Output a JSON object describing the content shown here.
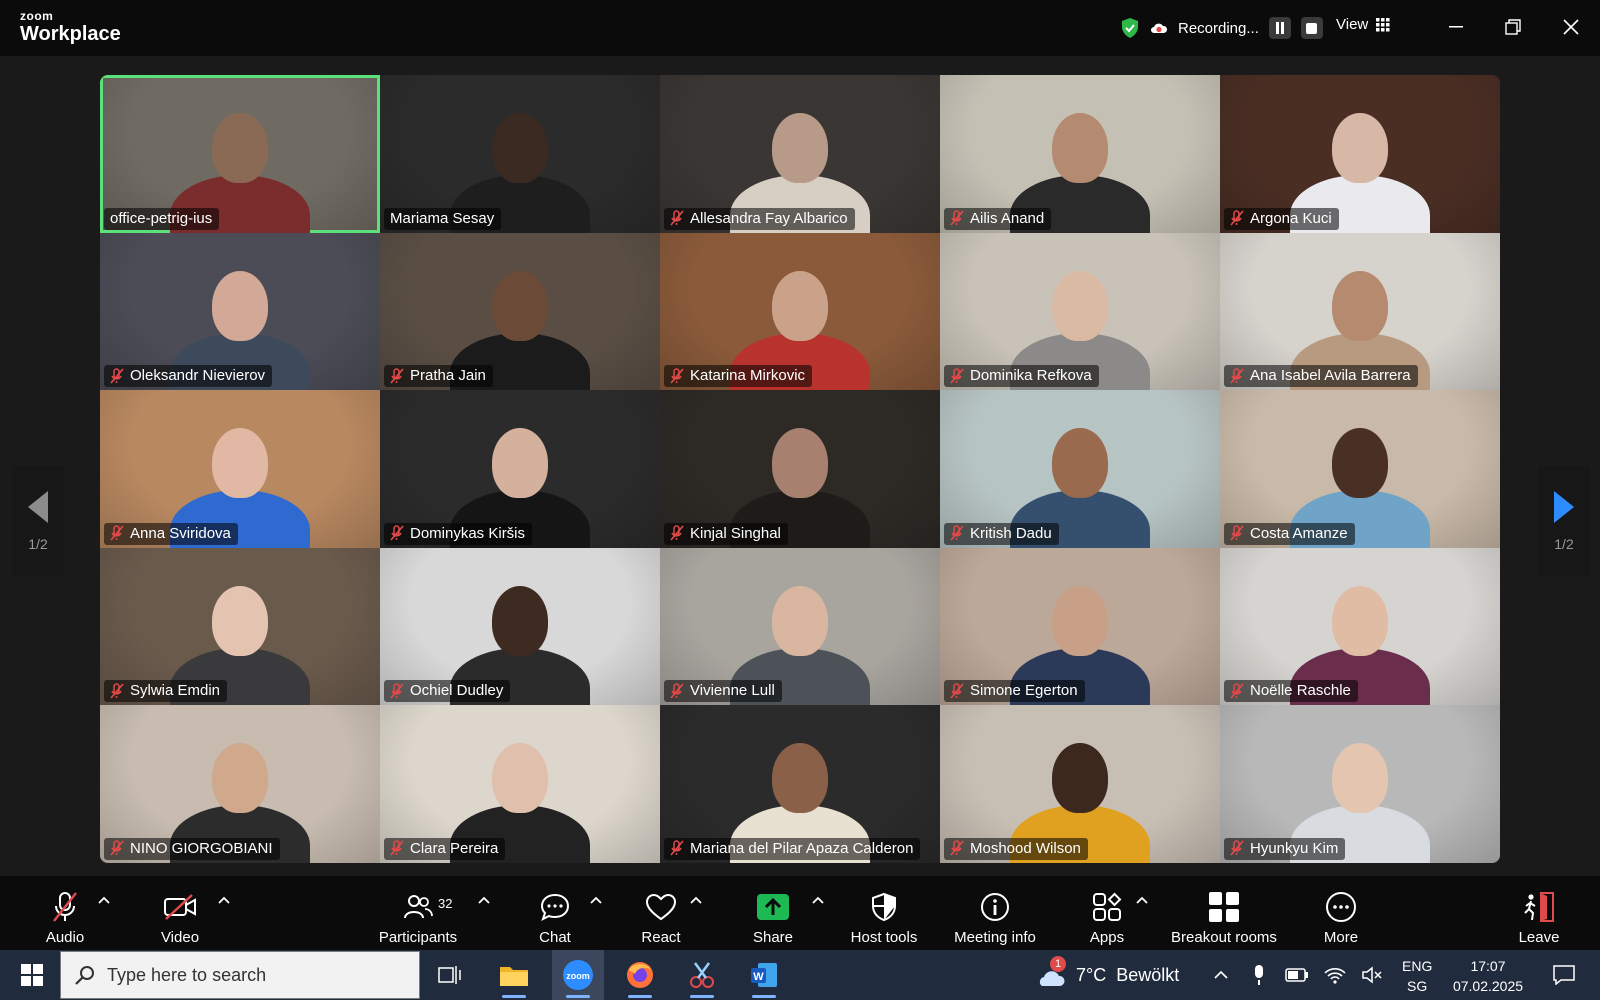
{
  "app": {
    "logo_small": "zoom",
    "logo_big": "Workplace"
  },
  "header": {
    "recording_label": "Recording...",
    "view_label": "View"
  },
  "pager": {
    "left": "1/2",
    "right": "1/2"
  },
  "participants": [
    {
      "name": "office-petrig-ius",
      "muted": false,
      "bg": "#6f6a62",
      "skin": "#8a6a55",
      "shirt": "#7b2c2c",
      "active": true
    },
    {
      "name": "Mariama Sesay",
      "muted": false,
      "bg": "#2b2b2b",
      "skin": "#3b2a22",
      "shirt": "#1e1e1e"
    },
    {
      "name": "Allesandra Fay Albarico",
      "muted": true,
      "bg": "#3a3634",
      "skin": "#b89a88",
      "shirt": "#d7cfc4"
    },
    {
      "name": "Ailis Anand",
      "muted": true,
      "bg": "#c4c0b4",
      "skin": "#b48a70",
      "shirt": "#2a2a2a"
    },
    {
      "name": "Argona Kuci",
      "muted": true,
      "bg": "#4a2e24",
      "skin": "#d7b7a6",
      "shirt": "#e9e9ee"
    },
    {
      "name": "Oleksandr Nievierov",
      "muted": true,
      "bg": "#4b4c56",
      "skin": "#d2a896",
      "shirt": "#3d4a5c"
    },
    {
      "name": "Pratha Jain",
      "muted": true,
      "bg": "#5a4e44",
      "skin": "#6b4a38",
      "shirt": "#1b1b1b"
    },
    {
      "name": "Katarina Mirkovic",
      "muted": true,
      "bg": "#8a5a3a",
      "skin": "#caa28a",
      "shirt": "#b8332e"
    },
    {
      "name": "Dominika Refkova",
      "muted": true,
      "bg": "#c8c2b8",
      "skin": "#dbbaa4",
      "shirt": "#8c8a88"
    },
    {
      "name": "Ana Isabel Avila Barrera",
      "muted": true,
      "bg": "#d6d2cc",
      "skin": "#b68a6e",
      "shirt": "#b79a80"
    },
    {
      "name": "Anna Sviridova",
      "muted": true,
      "bg": "#b88860",
      "skin": "#e0b8a4",
      "shirt": "#2f6ad0"
    },
    {
      "name": "Dominykas Kiršis",
      "muted": true,
      "bg": "#2b2b2b",
      "skin": "#d4b19c",
      "shirt": "#151515"
    },
    {
      "name": "Kinjal Singhal",
      "muted": true,
      "bg": "#2d2a26",
      "skin": "#a88070",
      "shirt": "#1e1b19"
    },
    {
      "name": "Kritish Dadu",
      "muted": true,
      "bg": "#b7c4c4",
      "skin": "#9a6a4e",
      "shirt": "#34506e"
    },
    {
      "name": "Costa Amanze",
      "muted": true,
      "bg": "#c9b9a8",
      "skin": "#4a3024",
      "shirt": "#6fa3c8"
    },
    {
      "name": "Sylwia Emdin",
      "muted": true,
      "bg": "#6a5a4c",
      "skin": "#e4c3b0",
      "shirt": "#3a3a3c"
    },
    {
      "name": "Ochiel Dudley",
      "muted": true,
      "bg": "#d8d8d8",
      "skin": "#3d2a20",
      "shirt": "#2b2b2b"
    },
    {
      "name": "Vivienne Lull",
      "muted": true,
      "bg": "#a8a49e",
      "skin": "#d8b6a0",
      "shirt": "#4c5258"
    },
    {
      "name": "Simone Egerton",
      "muted": true,
      "bg": "#bca898",
      "skin": "#c8a088",
      "shirt": "#2b3a58"
    },
    {
      "name": "Noëlle Raschle",
      "muted": true,
      "bg": "#d6d4d0",
      "skin": "#e0bca4",
      "shirt": "#6a2e4c"
    },
    {
      "name": "NINO GIORGOBIANI",
      "muted": true,
      "bg": "#c8bcb0",
      "skin": "#d0a88c",
      "shirt": "#2c2c2c"
    },
    {
      "name": "Clara Pereira",
      "muted": true,
      "bg": "#dcd6cc",
      "skin": "#e0c0ac",
      "shirt": "#222222"
    },
    {
      "name": "Mariana del Pilar Apaza Calderon",
      "muted": true,
      "bg": "#2b2b2b",
      "skin": "#8a6048",
      "shirt": "#e8e0d0"
    },
    {
      "name": "Moshood Wilson",
      "muted": true,
      "bg": "#c8bfb4",
      "skin": "#3d281e",
      "shirt": "#e0a020"
    },
    {
      "name": "Hyunkyu Kim",
      "muted": true,
      "bg": "#b8b8b8",
      "skin": "#e4c6b0",
      "shirt": "#d8dce0"
    }
  ],
  "toolbar": {
    "audio": "Audio",
    "video": "Video",
    "participants": "Participants",
    "participants_count": "32",
    "chat": "Chat",
    "react": "React",
    "share": "Share",
    "host_tools": "Host tools",
    "meeting_info": "Meeting info",
    "apps": "Apps",
    "breakout_rooms": "Breakout rooms",
    "more": "More",
    "leave": "Leave"
  },
  "taskbar": {
    "search_placeholder": "Type here to search",
    "weather_badge": "1",
    "weather_temp": "7°C",
    "weather_desc": "Bewölkt",
    "lang_top": "ENG",
    "lang_bottom": "SG",
    "time": "17:07",
    "date": "07.02.2025"
  },
  "colors": {
    "accent_green": "#5ce17a",
    "share_green": "#1db954",
    "muted_red": "#e04a4a",
    "taskbar": "#202b3d"
  }
}
